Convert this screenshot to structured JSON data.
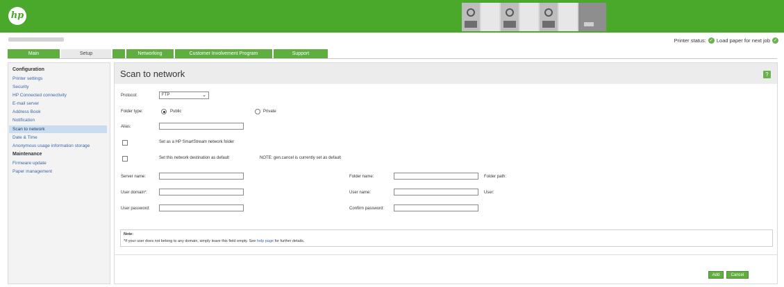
{
  "header": {
    "logo": "hp"
  },
  "status": {
    "label": "Printer status:",
    "message": "Load paper for next job"
  },
  "tabs": [
    {
      "label": "Main"
    },
    {
      "label": "Setup"
    },
    {
      "label": "Networking"
    },
    {
      "label": "Customer Involvement Program"
    },
    {
      "label": "Support"
    }
  ],
  "sidebar": {
    "config_heading": "Configuration",
    "config_items": [
      "Printer settings",
      "Security",
      "HP Connected connectivity",
      "E-mail server",
      "Address Book",
      "Notification",
      "Scan to network",
      "Date & Time",
      "Anonymous usage information storage"
    ],
    "maint_heading": "Maintenance",
    "maint_items": [
      "Firmware update",
      "Paper management"
    ]
  },
  "form": {
    "title": "Scan to network",
    "help": "?",
    "protocol_label": "Protocol:",
    "protocol_value": "FTP",
    "folder_type_label": "Folder type:",
    "public_label": "Public",
    "private_label": "Private",
    "alias_label": "Alias:",
    "smartstream_label": "Set as a HP SmartStream network folder",
    "default_label": "Set this network destination as default",
    "default_note": "NOTE: gen.cancel is currently set as default",
    "server_name_label": "Server name:",
    "folder_name_label": "Folder name:",
    "folder_path_label": "Folder path:",
    "user_domain_label": "User domain*:",
    "user_name_label": "User name:",
    "user_label": "User:",
    "user_password_label": "User password:",
    "confirm_password_label": "Confirm password:",
    "note_title": "Note:",
    "note_text_before": "*If your user does not belong to any domain, simply leave this field empty. See",
    "note_link": "help page",
    "note_text_after": "for further details.",
    "add_button": "Add",
    "cancel_button": "Cancel"
  },
  "colors": {
    "brand": "#4aa82a",
    "tab": "#5fae3f",
    "link": "#3a66a8"
  }
}
